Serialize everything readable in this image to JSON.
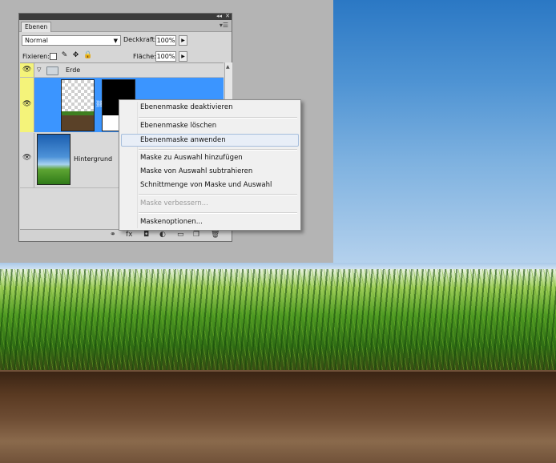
{
  "panel": {
    "tab_label": "Ebenen",
    "blend_mode": "Normal",
    "opacity_label": "Deckkraft:",
    "opacity_value": "100%",
    "lock_label": "Fixieren:",
    "fill_label": "Fläche:",
    "fill_value": "100%",
    "layers": [
      {
        "name": "Erde",
        "type": "group"
      },
      {
        "name": "Hintergrund",
        "type": "layer"
      }
    ]
  },
  "context_menu": {
    "items": [
      {
        "label": "Ebenenmaske deaktivieren",
        "enabled": true
      },
      {
        "label": "Ebenenmaske löschen",
        "enabled": true
      },
      {
        "label": "Ebenenmaske anwenden",
        "enabled": true,
        "highlighted": true
      },
      {
        "label": "Maske zu Auswahl hinzufügen",
        "enabled": true
      },
      {
        "label": "Maske von Auswahl subtrahieren",
        "enabled": true
      },
      {
        "label": "Schnittmenge von Maske und Auswahl",
        "enabled": true
      },
      {
        "label": "Maske verbessern...",
        "enabled": false
      },
      {
        "label": "Maskenoptionen...",
        "enabled": true
      }
    ]
  },
  "icons": {
    "visibility": "eye-icon",
    "folder": "folder-icon",
    "link": "chain-icon"
  }
}
